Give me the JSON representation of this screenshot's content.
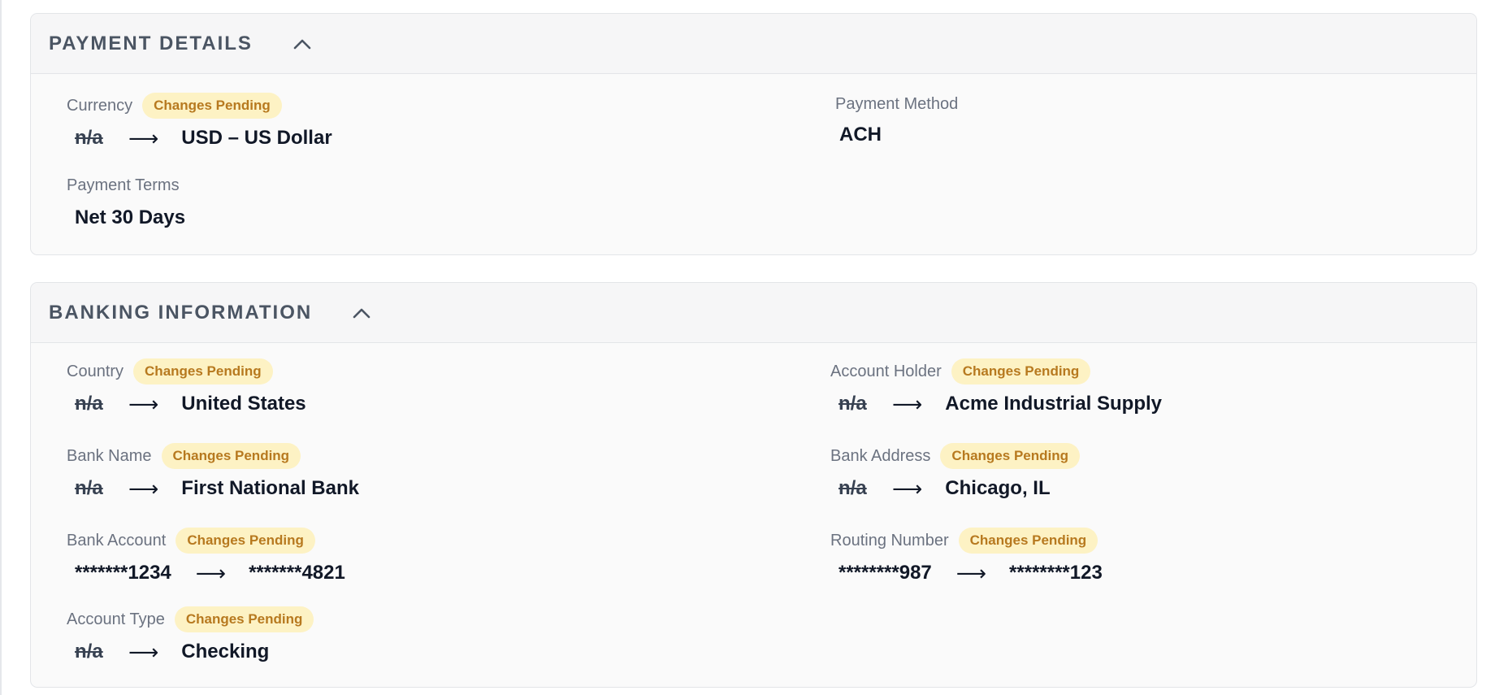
{
  "payment_details": {
    "title": "PAYMENT DETAILS",
    "currency": {
      "label": "Currency",
      "badge": "Changes Pending",
      "old_value": "n/a",
      "arrow": "⟶",
      "new_value": "USD – US Dollar"
    },
    "payment_method": {
      "label": "Payment Method",
      "value": "ACH"
    },
    "payment_terms": {
      "label": "Payment Terms",
      "value": "Net 30 Days"
    }
  },
  "banking_information": {
    "title": "BANKING INFORMATION",
    "country": {
      "label": "Country",
      "badge": "Changes Pending",
      "old_value": "n/a",
      "arrow": "⟶",
      "new_value": "United States"
    },
    "account_holder": {
      "label": "Account Holder",
      "badge": "Changes Pending",
      "old_value": "n/a",
      "arrow": "⟶",
      "new_value": "Acme Industrial Supply"
    },
    "bank_name": {
      "label": "Bank Name",
      "badge": "Changes Pending",
      "old_value": "n/a",
      "arrow": "⟶",
      "new_value": "First National Bank"
    },
    "bank_address": {
      "label": "Bank Address",
      "badge": "Changes Pending",
      "old_value": "n/a",
      "arrow": "⟶",
      "new_value": "Chicago, IL"
    },
    "bank_account": {
      "label": "Bank Account",
      "badge": "Changes Pending",
      "old_value": "*******1234",
      "arrow": "⟶",
      "new_value": "*******4821"
    },
    "routing_number": {
      "label": "Routing Number",
      "badge": "Changes Pending",
      "old_value": "********987",
      "arrow": "⟶",
      "new_value": "********123"
    },
    "account_type": {
      "label": "Account Type",
      "badge": "Changes Pending",
      "old_value": "n/a",
      "arrow": "⟶",
      "new_value": "Checking"
    }
  },
  "icons": {
    "collapse": "chevron-up-icon"
  },
  "colors": {
    "badge_background": "#fdf2c4",
    "badge_text": "#b7791f",
    "title_text": "#4b5563",
    "label_text": "#6b7280",
    "value_text": "#111827"
  }
}
